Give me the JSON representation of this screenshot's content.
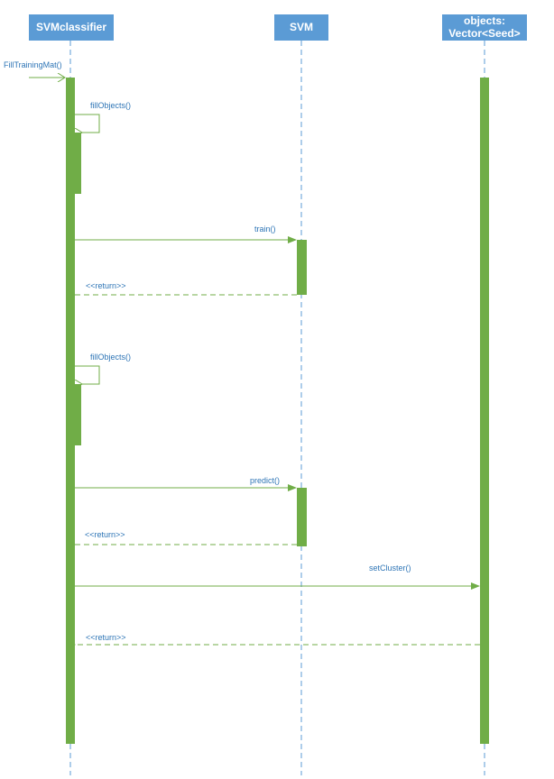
{
  "colors": {
    "header_fill": "#5b9bd5",
    "header_text": "#ffffff",
    "lifeline": "#5b9bd5",
    "activation": "#70ad47",
    "message": "#70ad47",
    "label_text": "#2e75b6"
  },
  "participants": [
    {
      "id": "svmclassifier",
      "name": "SVMclassifier"
    },
    {
      "id": "svm",
      "name": "SVM"
    },
    {
      "id": "objects",
      "name_line1": "objects:",
      "name_line2": "Vector<Seed>"
    }
  ],
  "messages": {
    "fill_training_mat": "FillTrainingMat()",
    "fill_objects_1": "fillObjects()",
    "train": "train()",
    "return_1": "<<return>>",
    "fill_objects_2": "fillObjects()",
    "predict": "predict()",
    "return_2": "<<return>>",
    "set_cluster": "setCluster()",
    "return_3": "<<return>>"
  }
}
